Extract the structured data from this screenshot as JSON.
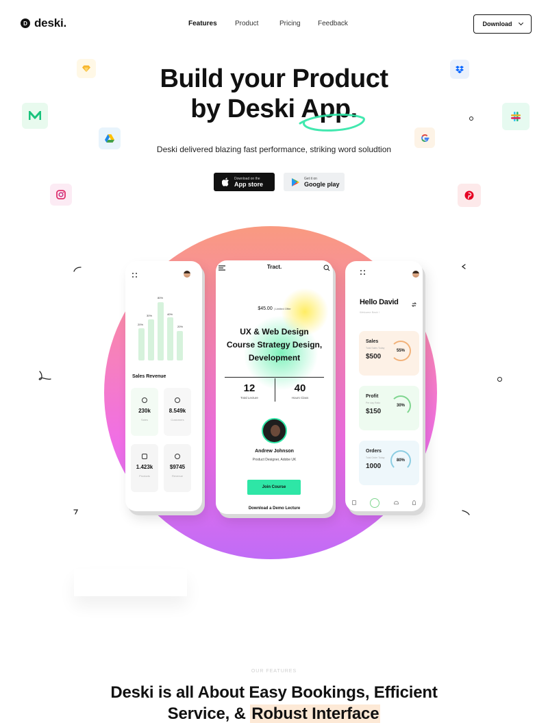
{
  "brand": {
    "name": "deski.",
    "mark": "D"
  },
  "nav": {
    "items": [
      {
        "label": "Features",
        "active": true
      },
      {
        "label": "Product",
        "active": false
      },
      {
        "label": "Pricing",
        "active": false
      },
      {
        "label": "Feedback",
        "active": false
      }
    ],
    "download_label": "Download"
  },
  "hero": {
    "title_line1": "Build your Product",
    "title_line2": "by Deski App.",
    "subtitle": "Deski delivered blazing fast performance, striking word soludtion",
    "app_store_small": "Download on the",
    "app_store_big": "App store",
    "google_small": "Get it on",
    "google_big": "Google play"
  },
  "floating_icons": [
    "sketch-icon",
    "medium-icon",
    "google-drive-icon",
    "instagram-icon",
    "dropbox-icon",
    "slack-icon",
    "google-icon",
    "pinterest-icon"
  ],
  "left_phone": {
    "bar_labels": [
      "20%",
      "30%",
      "80%",
      "40%",
      "20%"
    ],
    "section_title": "Sales Revenue",
    "stats": [
      {
        "value": "230k",
        "label": "Sales"
      },
      {
        "value": "8.549k",
        "label": "Customers"
      },
      {
        "value": "1.423k",
        "label": "Products"
      },
      {
        "value": "$9745",
        "label": "Revenue"
      }
    ]
  },
  "mid_phone": {
    "brand": "Tract.",
    "price": "$45.00",
    "offer": "| Limited Offer",
    "course_title_1": "UX & Web Design",
    "course_title_2": "Course Strategy Design,",
    "course_title_3": "Development",
    "lectures_value": "12",
    "lectures_label": "Total Lecture",
    "hours_value": "40",
    "hours_label": "Hours Class",
    "instructor_name": "Andrew Johnson",
    "instructor_role": "Product Designer, Adobe UK",
    "join_label": "Join Course",
    "demo_label": "Download a Demo Lecture"
  },
  "right_phone": {
    "greeting": "Hello David",
    "welcome": "Welcome Back !",
    "cards": [
      {
        "title": "Sales",
        "sub": "Total Sales Today",
        "value": "$500",
        "percent": "55%",
        "color": "#fdf1e6",
        "ring": "#f2b27a"
      },
      {
        "title": "Profit",
        "sub": "Per day Ratio",
        "value": "$150",
        "percent": "30%",
        "color": "#eefbf0",
        "ring": "#7fd58f"
      },
      {
        "title": "Orders",
        "sub": "Total Order Today",
        "value": "1000",
        "percent": "80%",
        "color": "#eef7fb",
        "ring": "#8ccde2"
      }
    ]
  },
  "features": {
    "eyebrow": "OUR FEATURES",
    "title_part1": "Deski is all About Easy Bookings, Efficient",
    "title_part2": "Service, & ",
    "title_highlight": "Robust Interface"
  },
  "colors": {
    "accent_green": "#2ee6a6",
    "text": "#111111",
    "highlight": "#fde9d6"
  }
}
